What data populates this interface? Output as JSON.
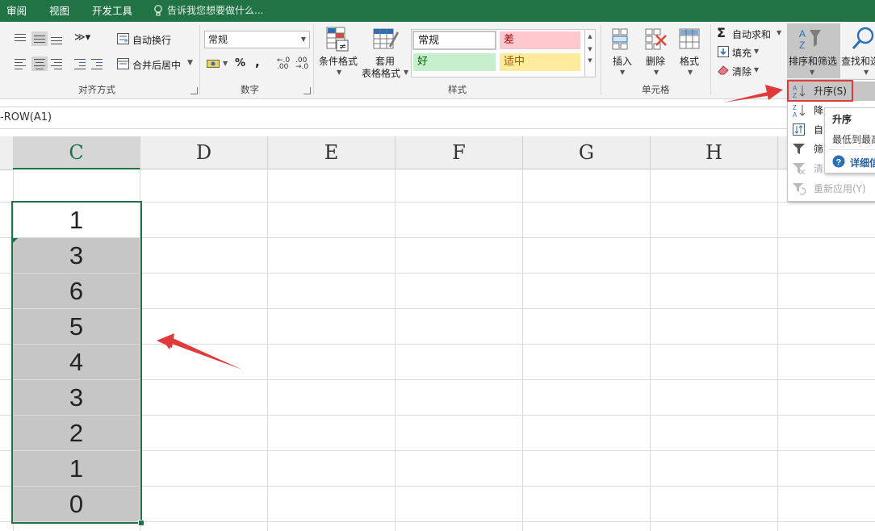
{
  "menu_tabs": [
    "审阅",
    "视图",
    "开发工具"
  ],
  "tell_me": "告诉我您想要做什么...",
  "alignment_group": {
    "label": "对齐方式",
    "wrap_text": "自动换行",
    "merge_center": "合并后居中"
  },
  "number_group": {
    "label": "数字",
    "format_value": "常规",
    "percent": "%",
    "comma": ",",
    "inc_decimal": "←.0\n.00",
    "dec_decimal": ".00\n→.0"
  },
  "styles_group": {
    "label": "样式",
    "conditional_format": "条件格式",
    "table_format_line1": "套用",
    "table_format_line2": "表格格式",
    "style_normal": "常规",
    "style_bad": "差",
    "style_good": "好",
    "style_neutral": "适中"
  },
  "cells_group": {
    "label": "单元格",
    "insert": "插入",
    "delete": "删除",
    "format": "格式"
  },
  "editing_group": {
    "autosum": "自动求和",
    "fill": "填充",
    "clear": "清除",
    "sort_filter": "排序和筛选",
    "find_select": "查找和选"
  },
  "formula_text": "-ROW(A1)",
  "columns": [
    "C",
    "D",
    "E",
    "F",
    "G",
    "H"
  ],
  "cell_values": [
    "1",
    "3",
    "6",
    "5",
    "4",
    "3",
    "2",
    "1",
    "0"
  ],
  "sort_menu": {
    "items": [
      {
        "label": "升序(S)",
        "icon": "sort-ascending-icon",
        "enabled": true
      },
      {
        "label": "降",
        "icon": "sort-descending-icon",
        "enabled": true
      },
      {
        "label": "自",
        "icon": "custom-sort-icon",
        "enabled": true
      },
      {
        "label": "筛",
        "icon": "filter-icon",
        "enabled": true
      },
      {
        "label": "清",
        "icon": "clear-filter-icon",
        "enabled": false
      },
      {
        "label": "重新应用(Y)",
        "icon": "reapply-icon",
        "enabled": false
      }
    ]
  },
  "tooltip": {
    "title": "升序",
    "desc": "最低到最高",
    "more": "详细信"
  },
  "colors": {
    "accent": "#217346",
    "selection_fill": "#c6c6c6",
    "highlight": "#e03a3a"
  }
}
